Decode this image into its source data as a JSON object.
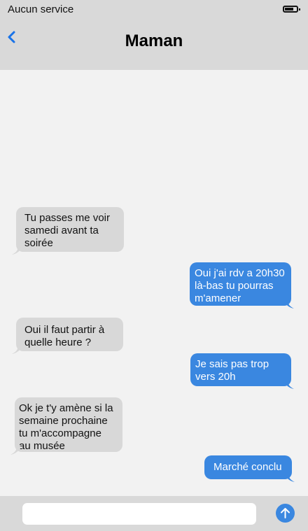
{
  "status_bar": {
    "carrier": "Aucun service",
    "battery_icon": "battery-icon"
  },
  "header": {
    "title": "Maman",
    "back_icon": "chevron-left-icon"
  },
  "colors": {
    "incoming": "#d8d8d8",
    "outgoing": "#3a87e0",
    "header": "#d9d9d9",
    "background": "#f2f2f2"
  },
  "messages": [
    {
      "from": "them",
      "lines": [
        "Tu passes me voir",
        "samedi avant ta",
        "soirée"
      ]
    },
    {
      "from": "me",
      "lines": [
        "Oui j'ai rdv a 20h30",
        "là-bas tu pourras",
        "m'amener"
      ]
    },
    {
      "from": "them",
      "lines": [
        "Oui il faut partir à",
        "quelle heure ?"
      ]
    },
    {
      "from": "me",
      "lines": [
        "Je sais pas trop",
        "vers 20h"
      ]
    },
    {
      "from": "them",
      "lines": [
        "Ok je t'y amène si la",
        "semaine prochaine",
        "tu m'accompagne",
        "au musée"
      ]
    },
    {
      "from": "me",
      "lines": [
        "Marché conclu"
      ]
    }
  ],
  "composer": {
    "value": "",
    "send_icon": "arrow-up-icon"
  }
}
